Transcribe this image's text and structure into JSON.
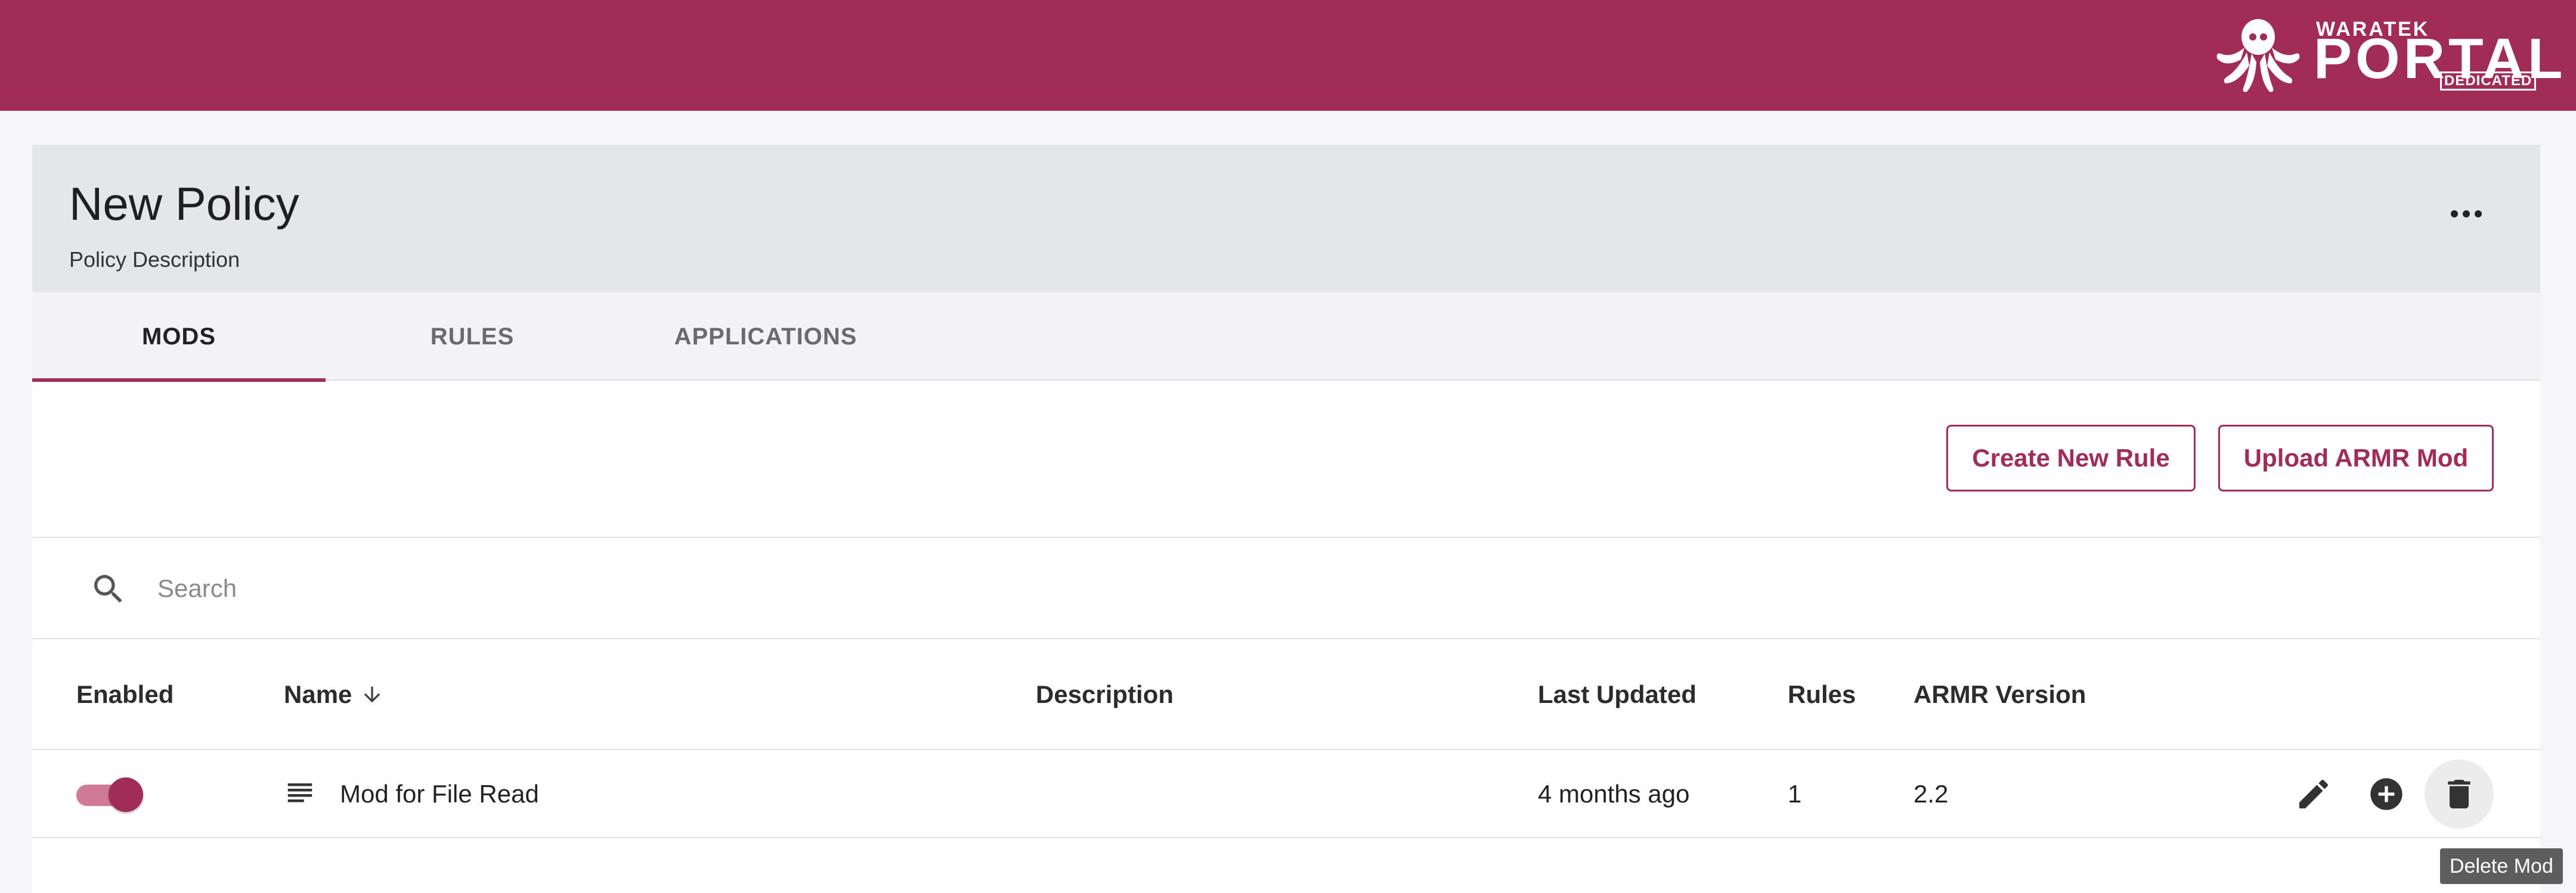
{
  "brand": {
    "top_text": "WARATEK",
    "main_text": "PORTAL",
    "tag_text": "DEDICATED",
    "color": "#a22c58"
  },
  "policy": {
    "title": "New Policy",
    "description": "Policy Description",
    "more_icon": "more-horizontal-icon"
  },
  "tabs": [
    {
      "label": "MODS",
      "active": true
    },
    {
      "label": "RULES",
      "active": false
    },
    {
      "label": "APPLICATIONS",
      "active": false
    }
  ],
  "actions": {
    "create_label": "Create New Rule",
    "upload_label": "Upload ARMR Mod"
  },
  "search": {
    "placeholder": "Search",
    "value": ""
  },
  "table": {
    "columns": [
      "Enabled",
      "Name",
      "Description",
      "Last Updated",
      "Rules",
      "ARMR Version"
    ],
    "sort": {
      "column": "Name",
      "direction": "descending"
    },
    "rows": [
      {
        "enabled": true,
        "icon": "list-icon",
        "name": "Mod for File Read",
        "description": "",
        "last_updated": "4 months ago",
        "rules": "1",
        "armr_version": "2.2"
      }
    ]
  },
  "row_actions": {
    "edit_icon": "pencil-icon",
    "add_icon": "add-circle-icon",
    "delete_icon": "trash-icon"
  },
  "tooltip": {
    "text": "Delete Mod"
  }
}
